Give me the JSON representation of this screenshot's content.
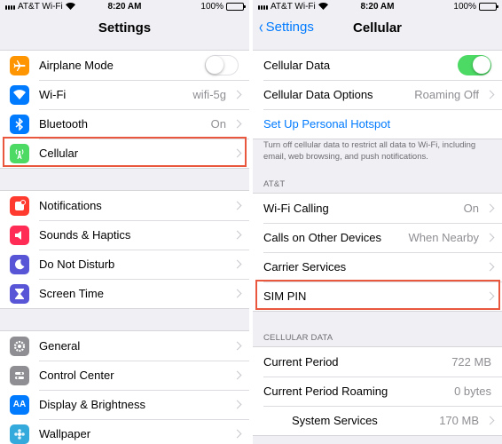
{
  "left": {
    "status": {
      "carrier": "AT&T Wi-Fi",
      "time": "8:20 AM",
      "battery": "100%"
    },
    "title": "Settings",
    "group1": [
      {
        "label": "Airplane Mode",
        "icon": "airplane-icon",
        "color": "#ff9500"
      },
      {
        "label": "Wi-Fi",
        "value": "wifi-5g",
        "icon": "wifi-icon",
        "color": "#007aff"
      },
      {
        "label": "Bluetooth",
        "value": "On",
        "icon": "bluetooth-icon",
        "color": "#007aff"
      },
      {
        "label": "Cellular",
        "icon": "cellular-antenna-icon",
        "color": "#4cd964"
      }
    ],
    "group2": [
      {
        "label": "Notifications",
        "icon": "notifications-icon",
        "color": "#ff3b30"
      },
      {
        "label": "Sounds & Haptics",
        "icon": "speaker-icon",
        "color": "#ff2d55"
      },
      {
        "label": "Do Not Disturb",
        "icon": "moon-icon",
        "color": "#5856d6"
      },
      {
        "label": "Screen Time",
        "icon": "hourglass-icon",
        "color": "#5856d6"
      }
    ],
    "group3": [
      {
        "label": "General",
        "icon": "gear-icon",
        "color": "#8e8e93"
      },
      {
        "label": "Control Center",
        "icon": "switches-icon",
        "color": "#8e8e93"
      },
      {
        "label": "Display & Brightness",
        "icon_text": "AA",
        "icon": "display-icon",
        "color": "#007aff"
      },
      {
        "label": "Wallpaper",
        "icon": "wallpaper-icon",
        "color": "#34aadc"
      }
    ]
  },
  "right": {
    "status": {
      "carrier": "AT&T Wi-Fi",
      "time": "8:20 AM",
      "battery": "100%"
    },
    "back_label": "Settings",
    "title": "Cellular",
    "cellular_data_label": "Cellular Data",
    "cellular_data_options_label": "Cellular Data Options",
    "cellular_data_options_value": "Roaming Off",
    "hotspot_label": "Set Up Personal Hotspot",
    "footer_note": "Turn off cellular data to restrict all data to Wi-Fi, including email, web browsing, and push notifications.",
    "carrier_header": "AT&T",
    "carrier_rows": [
      {
        "label": "Wi-Fi Calling",
        "value": "On"
      },
      {
        "label": "Calls on Other Devices",
        "value": "When Nearby"
      },
      {
        "label": "Carrier Services",
        "value": ""
      },
      {
        "label": "SIM PIN",
        "value": ""
      }
    ],
    "data_header": "CELLULAR DATA",
    "data_rows": [
      {
        "label": "Current Period",
        "value": "722 MB"
      },
      {
        "label": "Current Period Roaming",
        "value": "0 bytes"
      },
      {
        "label": "System Services",
        "value": "170 MB"
      }
    ]
  },
  "colors": {
    "highlight": "#e9573f",
    "toggle_on": "#4cd964",
    "link": "#007aff"
  }
}
